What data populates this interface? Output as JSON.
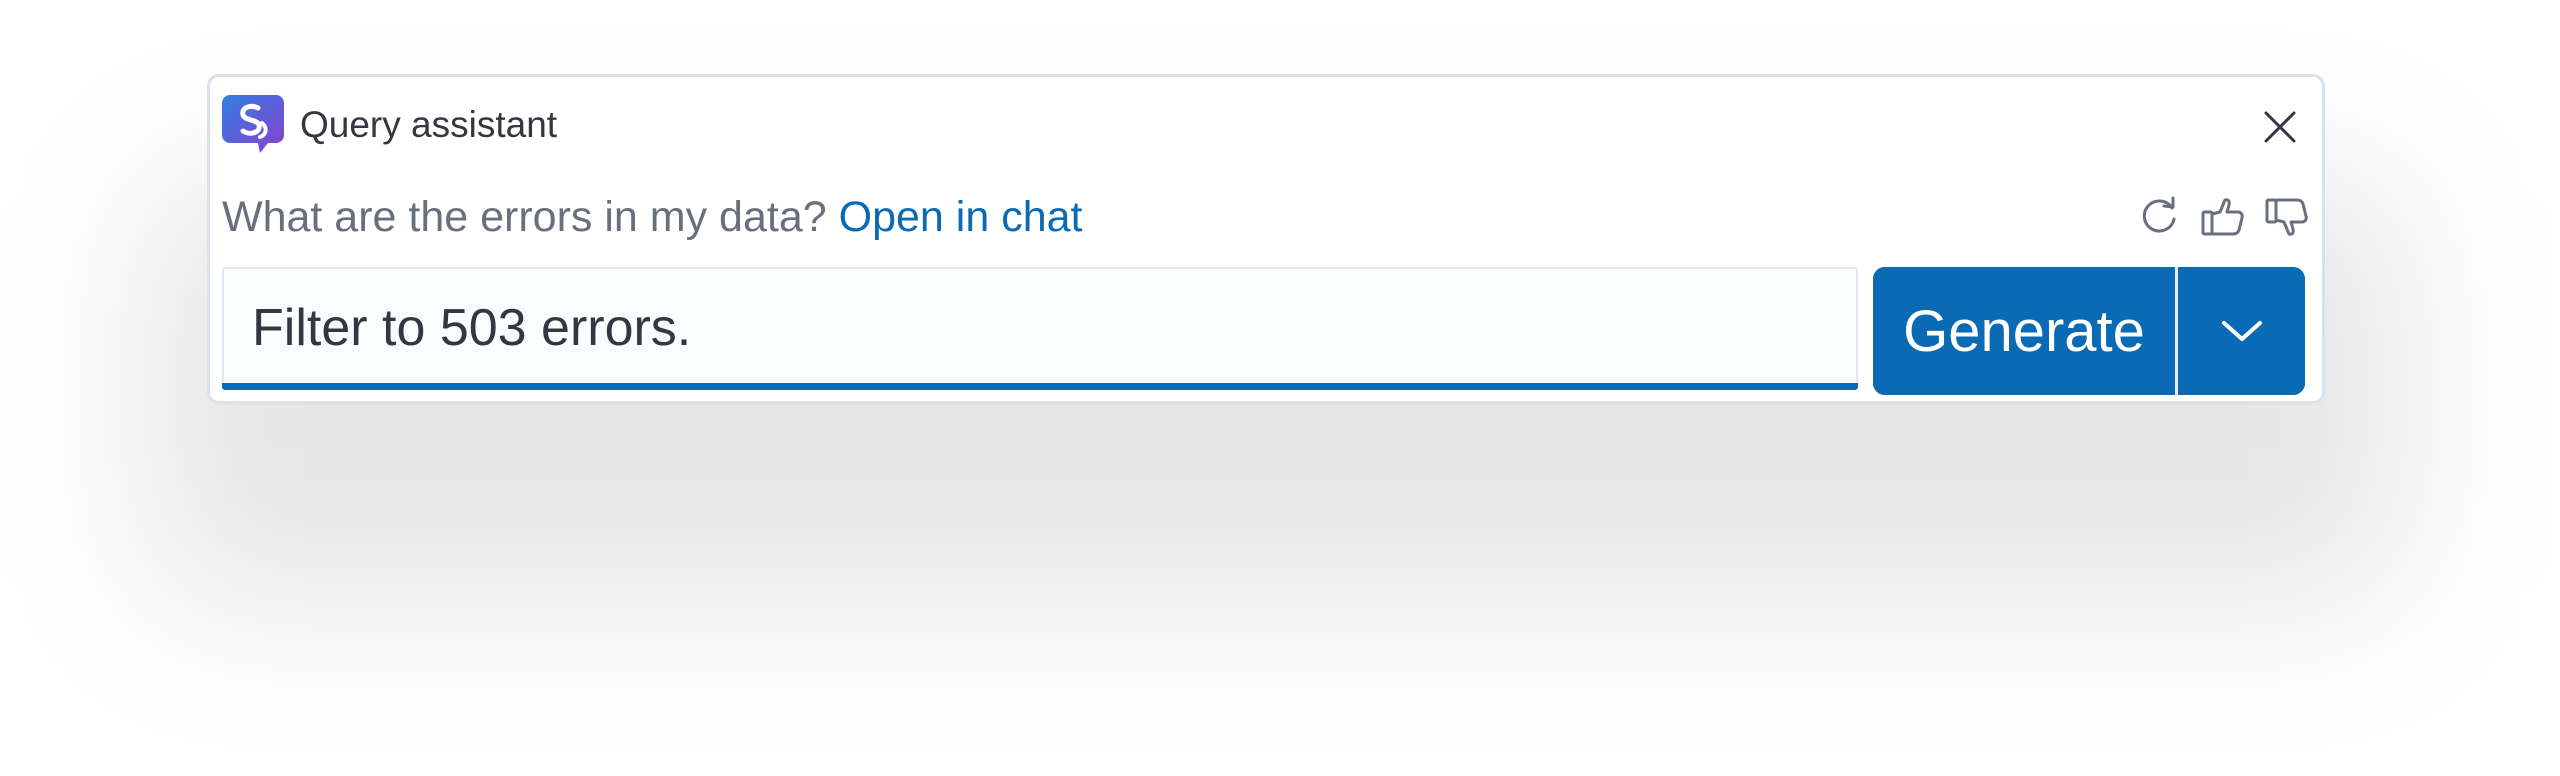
{
  "header": {
    "title": "Query assistant",
    "logo_icon": "assistant-logo-icon",
    "close_icon": "close-icon"
  },
  "prompt": {
    "question": "What are the errors in my data?",
    "open_chat_label": "Open in chat"
  },
  "actions": [
    {
      "name": "regenerate-icon"
    },
    {
      "name": "thumbs-up-icon"
    },
    {
      "name": "thumbs-down-icon"
    }
  ],
  "input": {
    "value": "Filter to 503 errors."
  },
  "generate": {
    "label": "Generate",
    "dropdown_icon": "chevron-down-icon"
  },
  "colors": {
    "accent": "#0a6bb4",
    "text": "#343741",
    "muted": "#69707d",
    "border": "#d9e1ea"
  }
}
